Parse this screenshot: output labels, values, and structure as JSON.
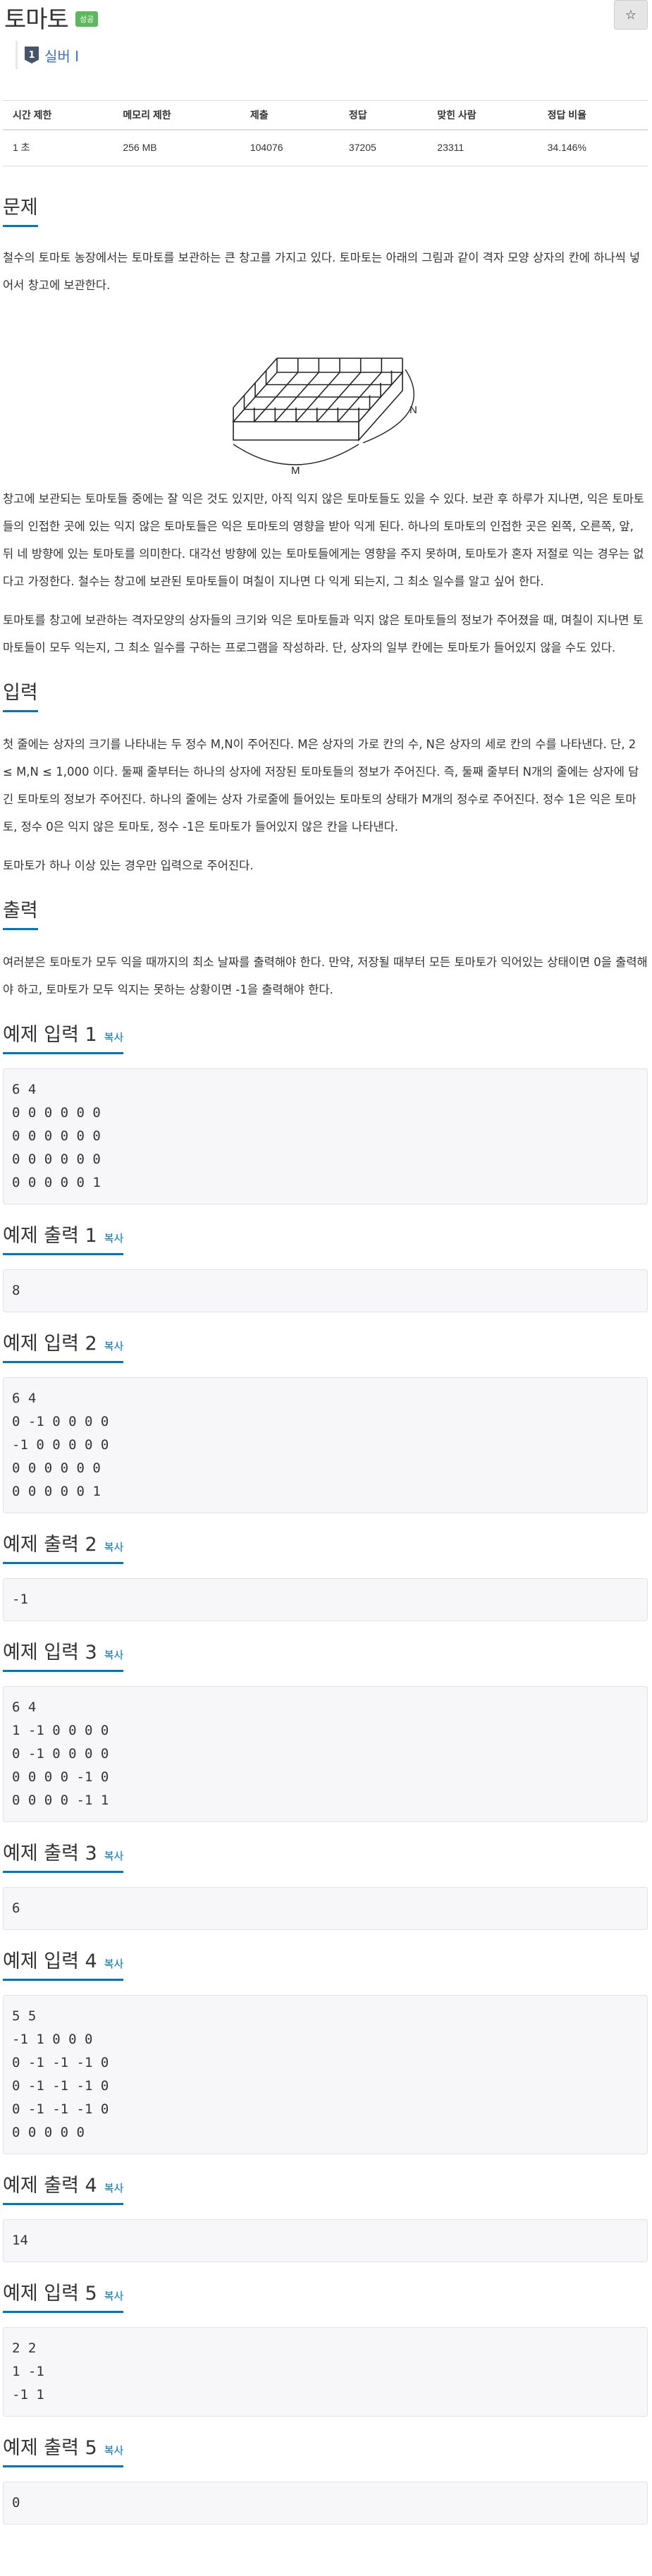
{
  "header": {
    "title": "토마토",
    "badge": "성공",
    "star": "☆",
    "tier_number": "1",
    "tier_label": "실버 I"
  },
  "info_table": {
    "headers": [
      "시간 제한",
      "메모리 제한",
      "제출",
      "정답",
      "맞힌 사람",
      "정답 비율"
    ],
    "values": [
      "1 초",
      "256 MB",
      "104076",
      "37205",
      "23311",
      "34.146%"
    ]
  },
  "problem": {
    "heading": "문제",
    "p1": "철수의 토마토 농장에서는 토마토를 보관하는 큰 창고를 가지고 있다. 토마토는 아래의 그림과 같이 격자 모양 상자의 칸에 하나씩 넣어서 창고에 보관한다.",
    "figure_label_n": "N",
    "figure_label_m": "M",
    "p2": "창고에 보관되는 토마토들 중에는 잘 익은 것도 있지만, 아직 익지 않은 토마토들도 있을 수 있다. 보관 후 하루가 지나면, 익은 토마토들의 인접한 곳에 있는 익지 않은 토마토들은 익은 토마토의 영향을 받아 익게 된다. 하나의 토마토의 인접한 곳은 왼쪽, 오른쪽, 앞, 뒤 네 방향에 있는 토마토를 의미한다. 대각선 방향에 있는 토마토들에게는 영향을 주지 못하며, 토마토가 혼자 저절로 익는 경우는 없다고 가정한다. 철수는 창고에 보관된 토마토들이 며칠이 지나면 다 익게 되는지, 그 최소 일수를 알고 싶어 한다.",
    "p3": "토마토를 창고에 보관하는 격자모양의 상자들의 크기와 익은 토마토들과 익지 않은 토마토들의 정보가 주어졌을 때, 며칠이 지나면 토마토들이 모두 익는지, 그 최소 일수를 구하는 프로그램을 작성하라. 단, 상자의 일부 칸에는 토마토가 들어있지 않을 수도 있다."
  },
  "input": {
    "heading": "입력",
    "p1": "첫 줄에는 상자의 크기를 나타내는 두 정수 M,N이 주어진다. M은 상자의 가로 칸의 수, N은 상자의 세로 칸의 수를 나타낸다. 단, 2 ≤ M,N ≤ 1,000 이다. 둘째 줄부터는 하나의 상자에 저장된 토마토들의 정보가 주어진다. 즉, 둘째 줄부터 N개의 줄에는 상자에 담긴 토마토의 정보가 주어진다. 하나의 줄에는 상자 가로줄에 들어있는 토마토의 상태가 M개의 정수로 주어진다. 정수 1은 익은 토마토, 정수 0은 익지 않은 토마토, 정수 -1은 토마토가 들어있지 않은 칸을 나타낸다.",
    "p2": "토마토가 하나 이상 있는 경우만 입력으로 주어진다."
  },
  "output": {
    "heading": "출력",
    "p1": "여러분은 토마토가 모두 익을 때까지의 최소 날짜를 출력해야 한다. 만약, 저장될 때부터 모든 토마토가 익어있는 상태이면 0을 출력해야 하고, 토마토가 모두 익지는 못하는 상황이면 -1을 출력해야 한다."
  },
  "copy_label": "복사",
  "samples": {
    "in1_title": "예제 입력 1",
    "in1": "6 4\n0 0 0 0 0 0\n0 0 0 0 0 0\n0 0 0 0 0 0\n0 0 0 0 0 1",
    "out1_title": "예제 출력 1",
    "out1": "8",
    "in2_title": "예제 입력 2",
    "in2": "6 4\n0 -1 0 0 0 0\n-1 0 0 0 0 0\n0 0 0 0 0 0\n0 0 0 0 0 1",
    "out2_title": "예제 출력 2",
    "out2": "-1",
    "in3_title": "예제 입력 3",
    "in3": "6 4\n1 -1 0 0 0 0\n0 -1 0 0 0 0\n0 0 0 0 -1 0\n0 0 0 0 -1 1",
    "out3_title": "예제 출력 3",
    "out3": "6",
    "in4_title": "예제 입력 4",
    "in4": "5 5\n-1 1 0 0 0\n0 -1 -1 -1 0\n0 -1 -1 -1 0\n0 -1 -1 -1 0\n0 0 0 0 0",
    "out4_title": "예제 출력 4",
    "out4": "14",
    "in5_title": "예제 입력 5",
    "in5": "2 2\n1 -1\n-1 1",
    "out5_title": "예제 출력 5",
    "out5": "0"
  }
}
